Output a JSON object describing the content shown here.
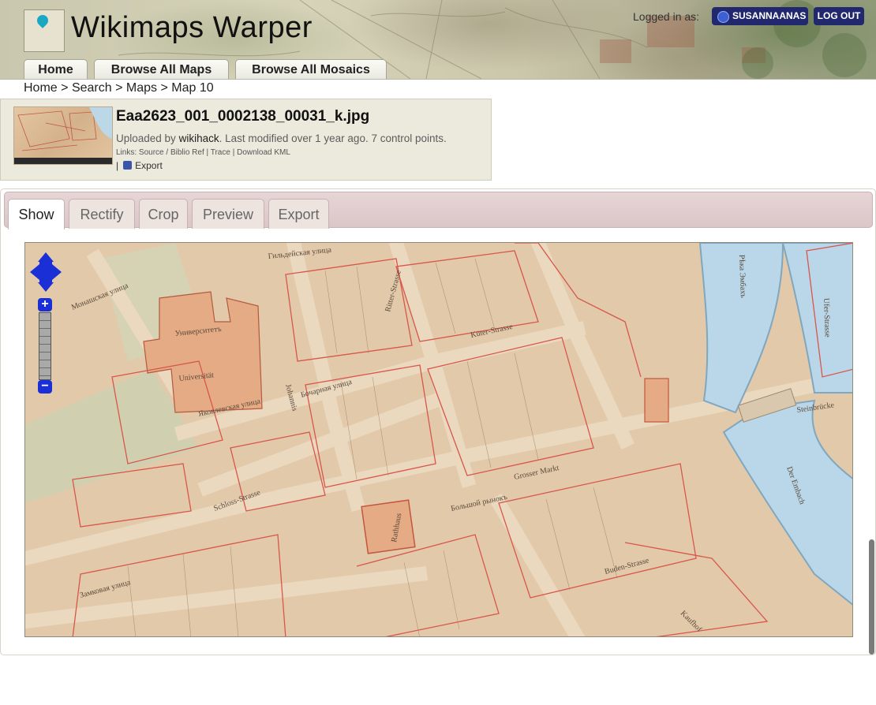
{
  "app": {
    "title": "Wikimaps Warper",
    "logged_in_label": "Logged in as:",
    "username": "SUSANNAANAS",
    "logout_label": "LOG OUT"
  },
  "nav": {
    "tabs": [
      {
        "label": "Home"
      },
      {
        "label": "Browse All Maps"
      },
      {
        "label": "Browse All Mosaics"
      }
    ]
  },
  "breadcrumb": {
    "items": [
      "Home",
      "Search",
      "Maps",
      "Map 10"
    ],
    "separator": ">"
  },
  "map_info": {
    "filename": "Eaa2623_001_0002138_00031_k.jpg",
    "uploaded_prefix": "Uploaded by",
    "uploader": "wikihack",
    "uploaded_suffix": ". Last modified over 1 year ago. 7 control points.",
    "links_prefix": "Links:",
    "links": [
      "Source",
      "Biblio Ref",
      "Trace",
      "Download KML"
    ],
    "export_label": "Export"
  },
  "tabs": [
    {
      "label": "Show",
      "active": true
    },
    {
      "label": "Rectify",
      "active": false
    },
    {
      "label": "Crop",
      "active": false
    },
    {
      "label": "Preview",
      "active": false
    },
    {
      "label": "Export",
      "active": false
    }
  ],
  "map_controls": {
    "zoom_in": "+",
    "zoom_out": "−"
  },
  "colors": {
    "header_button": "#21286e",
    "tab_bar": "#dbc6c8",
    "map_paper": "#e2c8a9",
    "map_lines": "#d8564a",
    "river": "#b9d7e8",
    "zoom_control": "#1b2fd6"
  },
  "map_text": [
    "Монашская улица",
    "Гильдейская улица",
    "Университетъ",
    "Universität",
    "Johannis",
    "Бочарная улица",
    "Яковлевская улица",
    "Ritter-Strasse",
    "Küter-Strasse",
    "Rathhaus",
    "Schloss-Strasse",
    "Grosser Markt",
    "Большой рынокъ",
    "Der Embach",
    "Рѣка Эмбахъ",
    "Ufer-Strasse",
    "Kaufhof",
    "Buden-Strasse",
    "Steinbrücke",
    "Замковая улица"
  ]
}
